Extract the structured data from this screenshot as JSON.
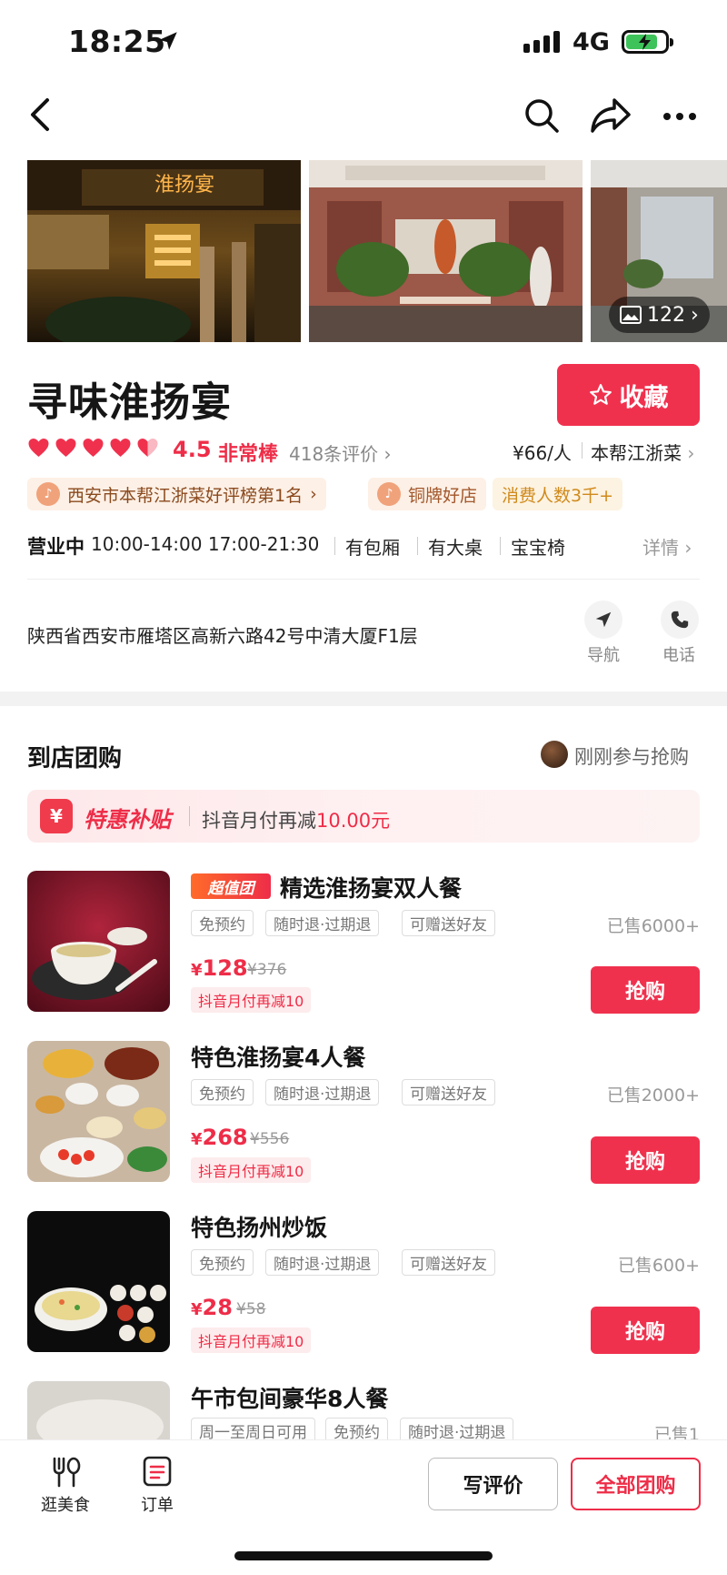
{
  "status_bar": {
    "time": "18:25",
    "network": "4G"
  },
  "nav": {
    "icons": [
      "back-icon",
      "search-icon",
      "share-icon",
      "more-icon"
    ]
  },
  "gallery": {
    "photo_count": "122",
    "sign_text": "淮扬宴"
  },
  "shop": {
    "name": "寻味淮扬宴",
    "favorite_label": "收藏",
    "rating": "4.5",
    "rating_word": "非常棒",
    "review_count": "418条评价",
    "price_per_person": "¥66/人",
    "cuisine": "本帮江浙菜",
    "tags": [
      "西安市本帮江浙菜好评榜第1名",
      "铜牌好店",
      "消费人数3千+"
    ],
    "hours_status": "营业中",
    "hours": "10:00-14:00 17:00-21:30",
    "facilities": [
      "有包厢",
      "有大桌",
      "宝宝椅"
    ],
    "details_label": "详情",
    "address": "陕西省西安市雁塔区高新六路42号中清大厦F1层",
    "nav_label": "导航",
    "phone_label": "电话"
  },
  "group_buy": {
    "title": "到店团购",
    "recent_label": "刚刚参与抢购",
    "subsidy": {
      "icon": "¥",
      "title": "特惠补贴",
      "text": "抖音月付再减",
      "amount": "10.00元"
    },
    "buy_label": "抢购",
    "deals": [
      {
        "badge": "超值团",
        "title": "精选淮扬宴双人餐",
        "chips": [
          "免预约",
          "随时退·过期退",
          "可赠送好友"
        ],
        "sold": "已售6000+",
        "price": "128",
        "old_price": "¥376",
        "pay_tag": "抖音月付再减10"
      },
      {
        "title": "特色淮扬宴4人餐",
        "chips": [
          "免预约",
          "随时退·过期退",
          "可赠送好友"
        ],
        "sold": "已售2000+",
        "price": "268",
        "old_price": "¥556",
        "pay_tag": "抖音月付再减10"
      },
      {
        "title": "特色扬州炒饭",
        "chips": [
          "免预约",
          "随时退·过期退",
          "可赠送好友"
        ],
        "sold": "已售600+",
        "price": "28",
        "old_price": "¥58",
        "pay_tag": "抖音月付再减10"
      },
      {
        "title": "午市包间豪华8人餐",
        "chips": [
          "周一至周日可用",
          "免预约",
          "随时退·过期退"
        ],
        "sold": "已售1"
      }
    ],
    "currency": "¥"
  },
  "bottom_bar": {
    "tabs": [
      {
        "label": "逛美食",
        "icon": "fork-spoon-icon"
      },
      {
        "label": "订单",
        "icon": "order-icon"
      }
    ],
    "review_button": "写评价",
    "all_deals_button": "全部团购"
  },
  "colors": {
    "accent": "#f0314e",
    "accent_text": "#ee2d48",
    "tag_bg": "#fdeced"
  }
}
